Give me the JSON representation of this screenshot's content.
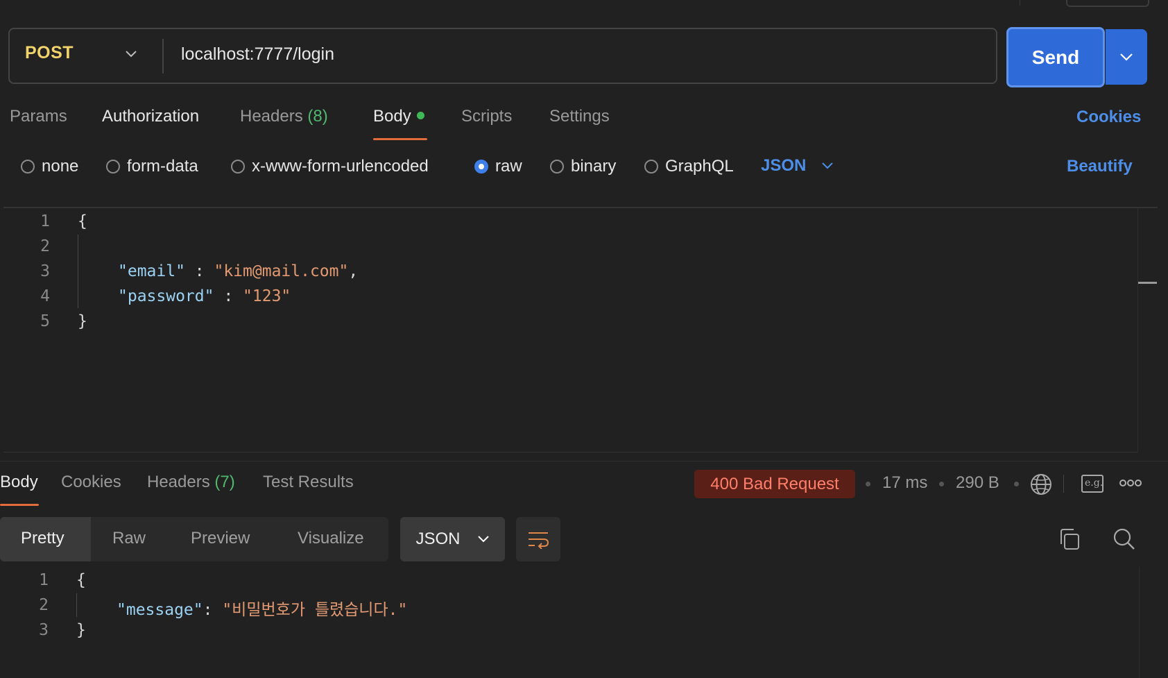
{
  "request": {
    "method": "POST",
    "url": "localhost:7777/login",
    "send_label": "Send"
  },
  "request_tabs": {
    "params": "Params",
    "authorization": "Authorization",
    "headers": "Headers",
    "headers_count": "(8)",
    "body": "Body",
    "scripts": "Scripts",
    "settings": "Settings",
    "cookies": "Cookies"
  },
  "body_types": {
    "none": "none",
    "form_data": "form-data",
    "urlencoded": "x-www-form-urlencoded",
    "raw": "raw",
    "binary": "binary",
    "graphql": "GraphQL",
    "selected": "raw",
    "language": "JSON",
    "beautify": "Beautify"
  },
  "request_body": {
    "line_numbers": [
      "1",
      "2",
      "3",
      "4",
      "5"
    ],
    "open_brace": "{",
    "email_key": "\"email\"",
    "email_sep": " : ",
    "email_value": "\"kim@mail.com\"",
    "comma": ",",
    "password_key": "\"password\"",
    "password_sep": " : ",
    "password_value": "\"123\"",
    "close_brace": "}"
  },
  "response_tabs": {
    "body": "Body",
    "cookies": "Cookies",
    "headers": "Headers",
    "headers_count": "(7)",
    "test_results": "Test Results"
  },
  "response_meta": {
    "status": "400 Bad Request",
    "time": "17 ms",
    "size": "290 B",
    "status_color": "#ff7f6b"
  },
  "response_view": {
    "pretty": "Pretty",
    "raw": "Raw",
    "preview": "Preview",
    "visualize": "Visualize",
    "format": "JSON"
  },
  "response_body": {
    "line_numbers": [
      "1",
      "2",
      "3"
    ],
    "open_brace": "{",
    "message_key": "\"message\"",
    "message_sep": ": ",
    "message_value": "\"비밀번호가 틀렸습니다.\"",
    "close_brace": "}"
  },
  "icons": {
    "eg_label": "e.g."
  },
  "colors": {
    "accent_blue": "#2f6bd8",
    "link_blue": "#4d8fe8",
    "tab_underline": "#e36d3a",
    "method_yellow": "#f2d46c",
    "success_green": "#3fb955"
  }
}
